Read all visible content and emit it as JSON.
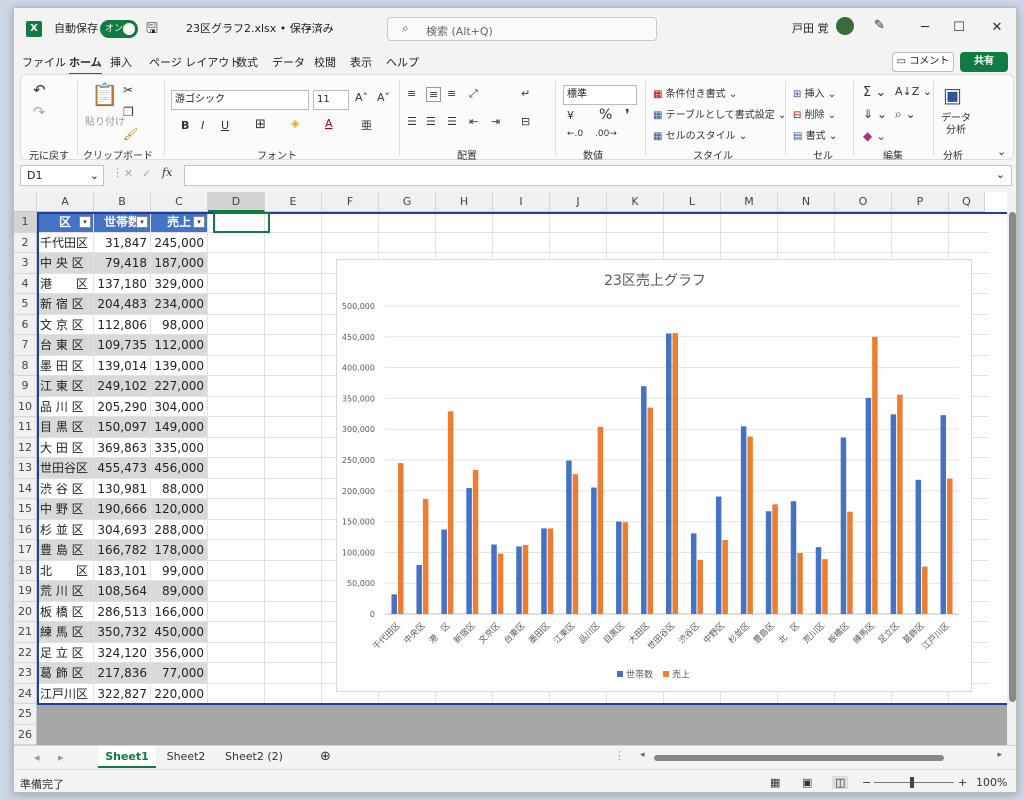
{
  "titlebar": {
    "autosave_label": "自動保存",
    "autosave_state": "オン",
    "file_title": "23区グラフ2.xlsx • 保存済み",
    "search_placeholder": "検索 (Alt+Q)",
    "user_name": "戸田 覚"
  },
  "menu_tabs": [
    "ファイル",
    "ホーム",
    "挿入",
    "ページ レイアウト",
    "数式",
    "データ",
    "校閲",
    "表示",
    "ヘルプ"
  ],
  "active_tab": "ホーム",
  "comment_button": "コメント",
  "share_button": "共有",
  "ribbon": {
    "groups": [
      "元に戻す",
      "クリップボード",
      "フォント",
      "配置",
      "数値",
      "スタイル",
      "セル",
      "編集",
      "分析"
    ],
    "paste_label": "貼り付け",
    "font_name": "游ゴシック",
    "font_size": "11",
    "number_format": "標準",
    "styles": [
      "条件付き書式",
      "テーブルとして書式設定",
      "セルのスタイル"
    ],
    "cells": [
      "挿入",
      "削除",
      "書式"
    ],
    "analysis_button": "データ分析"
  },
  "formula_bar": {
    "name_box": "D1",
    "fx": "fx"
  },
  "columns": [
    "A",
    "B",
    "C",
    "D",
    "E",
    "F",
    "G",
    "H",
    "I",
    "J",
    "K",
    "L",
    "M",
    "N",
    "O",
    "P",
    "Q"
  ],
  "table_headers": [
    "区",
    "世帯数",
    "売上"
  ],
  "rows": [
    [
      "千代田区",
      "31,847",
      "245,000"
    ],
    [
      "中 央 区",
      "79,418",
      "187,000"
    ],
    [
      "港　　区",
      "137,180",
      "329,000"
    ],
    [
      "新 宿 区",
      "204,483",
      "234,000"
    ],
    [
      "文 京 区",
      "112,806",
      "98,000"
    ],
    [
      "台 東 区",
      "109,735",
      "112,000"
    ],
    [
      "墨 田 区",
      "139,014",
      "139,000"
    ],
    [
      "江 東 区",
      "249,102",
      "227,000"
    ],
    [
      "品 川 区",
      "205,290",
      "304,000"
    ],
    [
      "目 黒 区",
      "150,097",
      "149,000"
    ],
    [
      "大 田 区",
      "369,863",
      "335,000"
    ],
    [
      "世田谷区",
      "455,473",
      "456,000"
    ],
    [
      "渋 谷 区",
      "130,981",
      "88,000"
    ],
    [
      "中 野 区",
      "190,666",
      "120,000"
    ],
    [
      "杉 並 区",
      "304,693",
      "288,000"
    ],
    [
      "豊 島 区",
      "166,782",
      "178,000"
    ],
    [
      "北　　区",
      "183,101",
      "99,000"
    ],
    [
      "荒 川 区",
      "108,564",
      "89,000"
    ],
    [
      "板 橋 区",
      "286,513",
      "166,000"
    ],
    [
      "練 馬 区",
      "350,732",
      "450,000"
    ],
    [
      "足 立 区",
      "324,120",
      "356,000"
    ],
    [
      "葛 飾 区",
      "217,836",
      "77,000"
    ],
    [
      "江戸川区",
      "322,827",
      "220,000"
    ]
  ],
  "chart_data": {
    "type": "bar",
    "title": "23区売上グラフ",
    "categories": [
      "千代田区",
      "中央区",
      "港　区",
      "新宿区",
      "文京区",
      "台東区",
      "墨田区",
      "江東区",
      "品川区",
      "目黒区",
      "大田区",
      "世田谷区",
      "渋谷区",
      "中野区",
      "杉並区",
      "豊島区",
      "北　区",
      "荒川区",
      "板橋区",
      "練馬区",
      "足立区",
      "葛飾区",
      "江戸川区"
    ],
    "series": [
      {
        "name": "世帯数",
        "color": "#4472c4",
        "values": [
          31847,
          79418,
          137180,
          204483,
          112806,
          109735,
          139014,
          249102,
          205290,
          150097,
          369863,
          455473,
          130981,
          190666,
          304693,
          166782,
          183101,
          108564,
          286513,
          350732,
          324120,
          217836,
          322827
        ]
      },
      {
        "name": "売上",
        "color": "#ed7d31",
        "values": [
          245000,
          187000,
          329000,
          234000,
          98000,
          112000,
          139000,
          227000,
          304000,
          149000,
          335000,
          456000,
          88000,
          120000,
          288000,
          178000,
          99000,
          89000,
          166000,
          450000,
          356000,
          77000,
          220000
        ]
      }
    ],
    "ylim": [
      0,
      500000
    ],
    "yticks": [
      "0",
      "50,000",
      "100,000",
      "150,000",
      "200,000",
      "250,000",
      "300,000",
      "350,000",
      "400,000",
      "450,000",
      "500,000"
    ],
    "legend_position": "bottom",
    "grid": true
  },
  "sheet_tabs": [
    "Sheet1",
    "Sheet2",
    "Sheet2 (2)"
  ],
  "active_sheet": "Sheet1",
  "status": {
    "ready": "準備完了",
    "zoom": "100%"
  }
}
